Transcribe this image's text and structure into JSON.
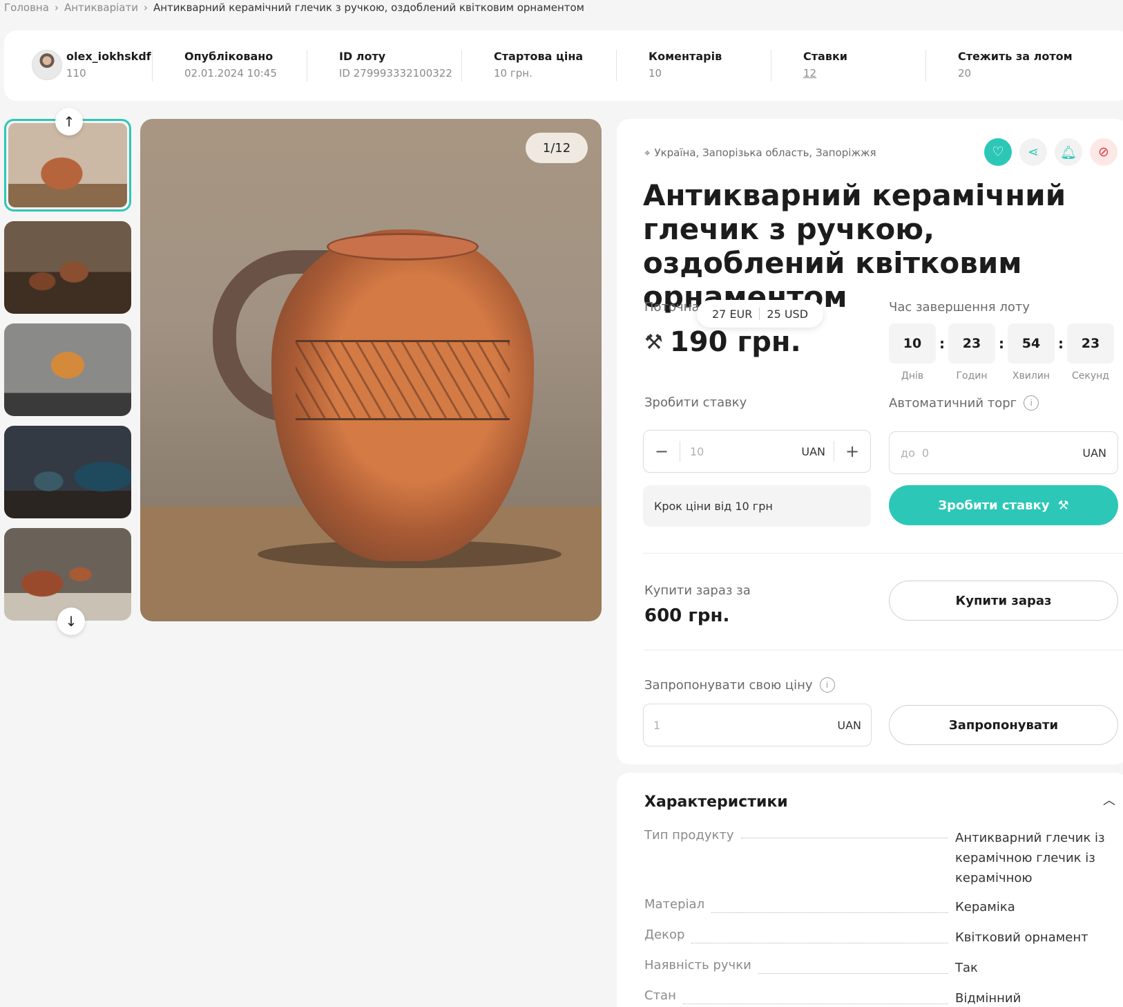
{
  "breadcrumb": {
    "home": "Головна",
    "category": "Антикваріати",
    "current": "Антикварний керамічний глечик з ручкою, оздоблений квітковим орнаментом"
  },
  "info": {
    "user": {
      "name": "olex_iokhskdf",
      "rating": "110"
    },
    "published": {
      "label": "Опубліковано",
      "value": "02.01.2024 10:45"
    },
    "lot_id": {
      "label": "ID лоту",
      "value": "ID 279993332100322"
    },
    "start_price": {
      "label": "Стартова ціна",
      "value": "10 грн."
    },
    "comments": {
      "label": "Коментарів",
      "value": "10"
    },
    "bids": {
      "label": "Ставки",
      "value": "12"
    },
    "watchers": {
      "label": "Стежить за лотом",
      "value": "20"
    }
  },
  "gallery": {
    "counter": "1/12",
    "thumbnails": [
      "jug-1",
      "jugs-with-books",
      "jug-orange",
      "jugs-blue-painted",
      "jugs-on-steps"
    ],
    "icons": {
      "up": "arrow-up-icon",
      "down": "arrow-down-icon"
    }
  },
  "lot": {
    "location": "Україна, Запорізька область, Запоріжжя",
    "title": "Антикварний керамічний глечик з ручкою, оздоблений квітковим орнаментом",
    "current_price_label": "Поточна",
    "current_price": "190 грн.",
    "currency_eur": "27 EUR",
    "currency_usd": "25 USD",
    "timer_label": "Час завершення лоту",
    "timer": [
      {
        "value": "10",
        "unit": "Днів"
      },
      {
        "value": "23",
        "unit": "Годин"
      },
      {
        "value": "54",
        "unit": "Хвилин"
      },
      {
        "value": "23",
        "unit": "Секунд"
      }
    ],
    "bid": {
      "label": "Зробити ставку",
      "placeholder": "10",
      "unit": "UAN",
      "step_note": "Крок ціни від 10 грн",
      "button": "Зробити ставку"
    },
    "autobid": {
      "label": "Автоматичний торг",
      "prefix": "до",
      "placeholder": "0",
      "unit": "UAN"
    },
    "buy_now": {
      "label": "Купити зараз за",
      "price": "600 грн.",
      "button": "Купити зараз"
    },
    "offer": {
      "label": "Запропонувати свою ціну",
      "placeholder": "1",
      "unit": "UAN",
      "button": "Запропонувати"
    }
  },
  "specs": {
    "title": "Характеристики",
    "rows": [
      {
        "key": "Тип продукту",
        "value": "Антикварний глечик із керамічною глечик із керамічною"
      },
      {
        "key": "Матеріал",
        "value": "Кераміка"
      },
      {
        "key": "Декор",
        "value": "Квітковий орнамент"
      },
      {
        "key": "Наявність ручки",
        "value": "Так"
      },
      {
        "key": "Стан",
        "value": "Відмінний"
      }
    ]
  },
  "colors": {
    "accent": "#2cc7b7",
    "danger": "#e53935"
  }
}
